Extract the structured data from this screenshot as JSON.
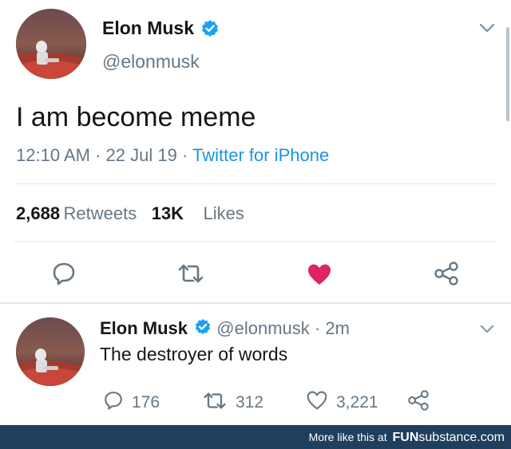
{
  "main_tweet": {
    "display_name": "Elon Musk",
    "handle": "@elonmusk",
    "text": "I am become meme",
    "time": "12:10 AM",
    "date": "22 Jul 19",
    "separator": "·",
    "source": "Twitter for iPhone",
    "retweets_count": "2,688",
    "retweets_label": "Retweets",
    "likes_count": "13K",
    "likes_label": "Likes",
    "liked": true,
    "like_color": "#e0245e"
  },
  "reply_tweet": {
    "display_name": "Elon Musk",
    "handle": "@elonmusk",
    "age": "· 2m",
    "text": "The destroyer of words",
    "reply_count": "176",
    "retweet_count": "312",
    "like_count": "3,221"
  },
  "footer": {
    "text": "More like this at",
    "brand_prefix": "FUN",
    "brand_rest": "substance",
    "brand_suffix": ".com"
  },
  "colors": {
    "verified": "#1da1f2",
    "link": "#1b95e0",
    "muted": "#657786",
    "footer_bg": "#1f3f5c"
  },
  "icons": [
    "verified-badge-icon",
    "chevron-down-icon",
    "reply-icon",
    "retweet-icon",
    "heart-icon",
    "share-icon"
  ]
}
